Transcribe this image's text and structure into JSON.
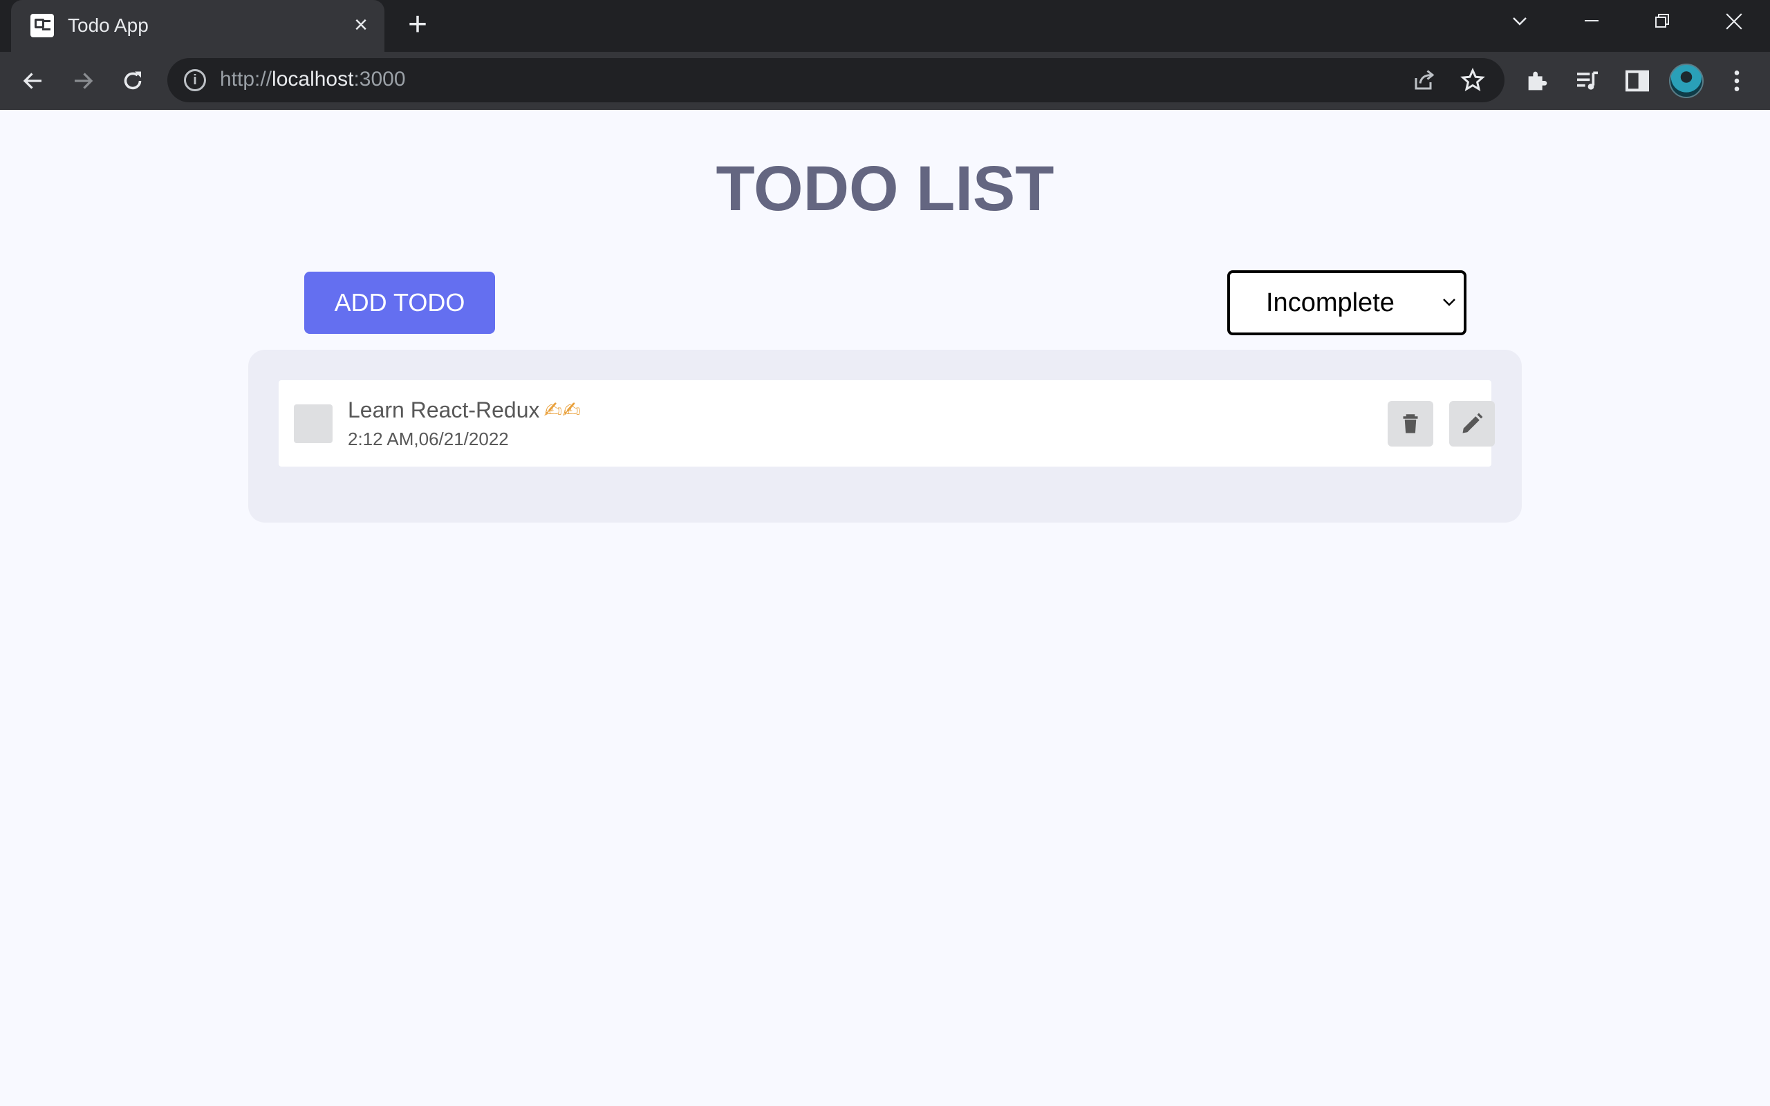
{
  "browser": {
    "tab_title": "Todo App",
    "url_scheme": "http://",
    "url_host": "localhost",
    "url_port": ":3000"
  },
  "page": {
    "title": "TODO LIST",
    "add_button_label": "ADD TODO",
    "filter": {
      "selected": "Incomplete"
    }
  },
  "todos": [
    {
      "title": "Learn React-Redux",
      "emoji": "✍✍",
      "time": "2:12 AM,06/21/2022",
      "completed": false
    }
  ],
  "colors": {
    "accent": "#646ff0",
    "title": "#646681",
    "panel": "#ecedf6",
    "page_bg": "#f8f9ff"
  }
}
